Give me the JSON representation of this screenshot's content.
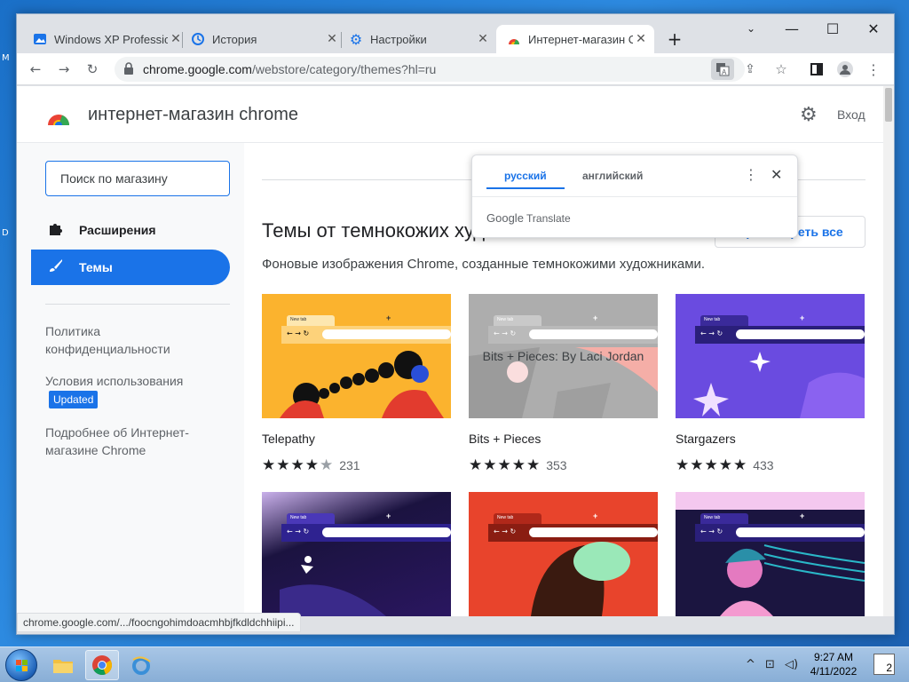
{
  "browser": {
    "tabs": [
      {
        "title": "Windows XP Professional",
        "icon": "website-icon"
      },
      {
        "title": "История",
        "icon": "history-icon"
      },
      {
        "title": "Настройки",
        "icon": "settings-icon"
      },
      {
        "title": "Интернет-магазин Chrome",
        "icon": "webstore-icon"
      }
    ],
    "url_host": "chrome.google.com",
    "url_path": "/webstore/category/themes?hl=ru",
    "status_url": "chrome.google.com/.../foocngohimdoacmhbjfkdldchhiipi..."
  },
  "translate_popup": {
    "lang_from": "русский",
    "lang_to": "английский",
    "brand": "Google",
    "brand_product": "Translate"
  },
  "store": {
    "title": "интернет-магазин chrome",
    "login": "Вход",
    "search_placeholder": "Поиск по магазину",
    "nav": [
      {
        "label": "Расширения",
        "icon": "puzzle-icon"
      },
      {
        "label": "Темы",
        "icon": "brush-icon"
      }
    ],
    "links": {
      "privacy": "Политика конфиденциальности",
      "terms": "Условия использования",
      "updated_badge": "Updated",
      "about": "Подробнее об Интернет-магазине Chrome"
    }
  },
  "section": {
    "title": "Темы от темнокожих художников",
    "subtitle": "Фоновые изображения Chrome, созданные темнокожими художниками.",
    "view_all": "Просмотреть все",
    "hover_tooltip": "Bits + Pieces: By Laci Jordan"
  },
  "themes": [
    {
      "name": "Telepathy",
      "rating": 4.0,
      "count": "231",
      "stars": "★★★★",
      "stars_empty": "★"
    },
    {
      "name": "Bits + Pieces",
      "rating": 4.5,
      "count": "353",
      "stars": "★★★★★",
      "stars_empty": ""
    },
    {
      "name": "Stargazers",
      "rating": 4.5,
      "count": "433",
      "stars": "★★★★★",
      "stars_empty": ""
    },
    {
      "name": "",
      "rating": null,
      "count": "",
      "stars": "",
      "stars_empty": ""
    },
    {
      "name": "",
      "rating": null,
      "count": "",
      "stars": "",
      "stars_empty": ""
    },
    {
      "name": "",
      "rating": null,
      "count": "",
      "stars": "",
      "stars_empty": ""
    }
  ],
  "mini_tab_label": "New tab",
  "taskbar": {
    "time": "9:27 AM",
    "date": "4/11/2022",
    "notifications": "2"
  },
  "desktop": {
    "left_letters": [
      "M",
      "D"
    ]
  }
}
